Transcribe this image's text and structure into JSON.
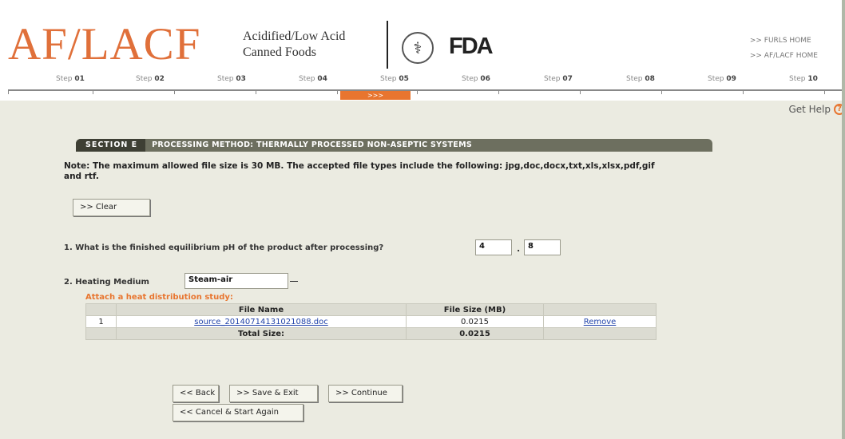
{
  "header": {
    "logo_main": "AF/LACF",
    "logo_sub_line1": "Acidified/Low Acid",
    "logo_sub_line2": "Canned Foods",
    "fda_logo": "FDA",
    "links": [
      ">> FURLS HOME",
      ">> AF/LACF HOME"
    ]
  },
  "steps": {
    "labels": [
      {
        "prefix": "Step",
        "num": "01"
      },
      {
        "prefix": "Step",
        "num": "02"
      },
      {
        "prefix": "Step",
        "num": "03"
      },
      {
        "prefix": "Step",
        "num": "04"
      },
      {
        "prefix": "Step",
        "num": "05"
      },
      {
        "prefix": "Step",
        "num": "06"
      },
      {
        "prefix": "Step",
        "num": "07"
      },
      {
        "prefix": "Step",
        "num": "08"
      },
      {
        "prefix": "Step",
        "num": "09"
      },
      {
        "prefix": "Step",
        "num": "10"
      }
    ],
    "current_marker": ">>>"
  },
  "help": {
    "label": "Get Help",
    "icon": "?"
  },
  "section": {
    "tag": "SECTION E",
    "title": "PROCESSING METHOD: THERMALLY PROCESSED NON-ASEPTIC SYSTEMS"
  },
  "note": "Note: The maximum allowed file size is 30 MB. The accepted file types include the following: jpg,doc,docx,txt,xls,xlsx,pdf,gif and rtf.",
  "buttons": {
    "clear": ">> Clear",
    "back": "<< Back",
    "save_exit": ">> Save & Exit",
    "continue": ">> Continue",
    "cancel": "<< Cancel & Start Again"
  },
  "q1": {
    "label": "1. What is the finished equilibrium pH of the product after processing?",
    "int_value": "4",
    "separator": ".",
    "dec_value": "8"
  },
  "q2": {
    "label": "2. Heating Medium",
    "value": "Steam-air"
  },
  "attach": {
    "label": "Attach a heat distribution study:",
    "headers": [
      "",
      "File Name",
      "File Size (MB)",
      ""
    ],
    "rows": [
      {
        "index": "1",
        "file_name": "source_20140714131021088.doc",
        "size": "0.0215",
        "action": "Remove"
      }
    ],
    "total_label": "Total Size:",
    "total_value": "0.0215"
  }
}
